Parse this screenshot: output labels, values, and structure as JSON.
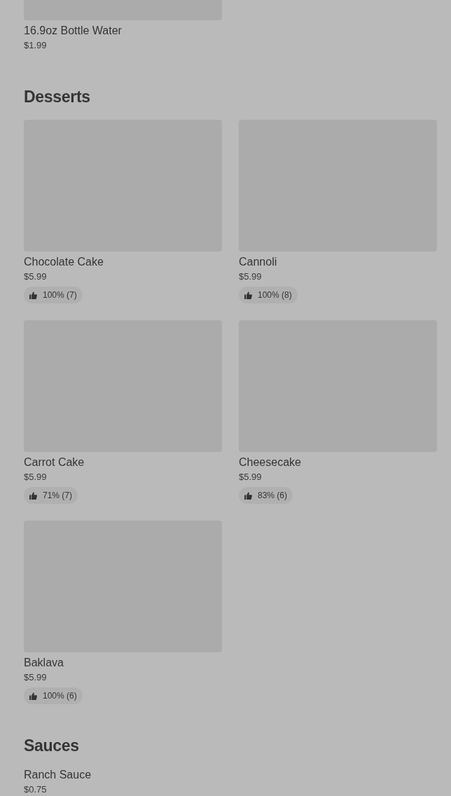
{
  "sections": [
    {
      "items": [
        {
          "kind": "photo",
          "cut": true,
          "name": "16.9oz Bottle Water",
          "price": "$1.99"
        }
      ]
    },
    {
      "title": "Desserts",
      "items": [
        {
          "kind": "photo",
          "name": "Chocolate Cake",
          "price": "$5.99",
          "rating": "100% (7)"
        },
        {
          "kind": "photo",
          "name": "Cannoli",
          "price": "$5.99",
          "rating": "100% (8)"
        },
        {
          "kind": "photo",
          "name": "Carrot Cake",
          "price": "$5.99",
          "rating": "71% (7)"
        },
        {
          "kind": "photo",
          "name": "Cheesecake",
          "price": "$5.99",
          "rating": "83% (6)"
        },
        {
          "kind": "photo",
          "name": "Baklava",
          "price": "$5.99",
          "rating": "100% (6)"
        }
      ]
    },
    {
      "title": "Sauces",
      "items": [
        {
          "kind": "plain",
          "name": "Ranch Sauce",
          "price": "$0.75"
        }
      ]
    }
  ]
}
